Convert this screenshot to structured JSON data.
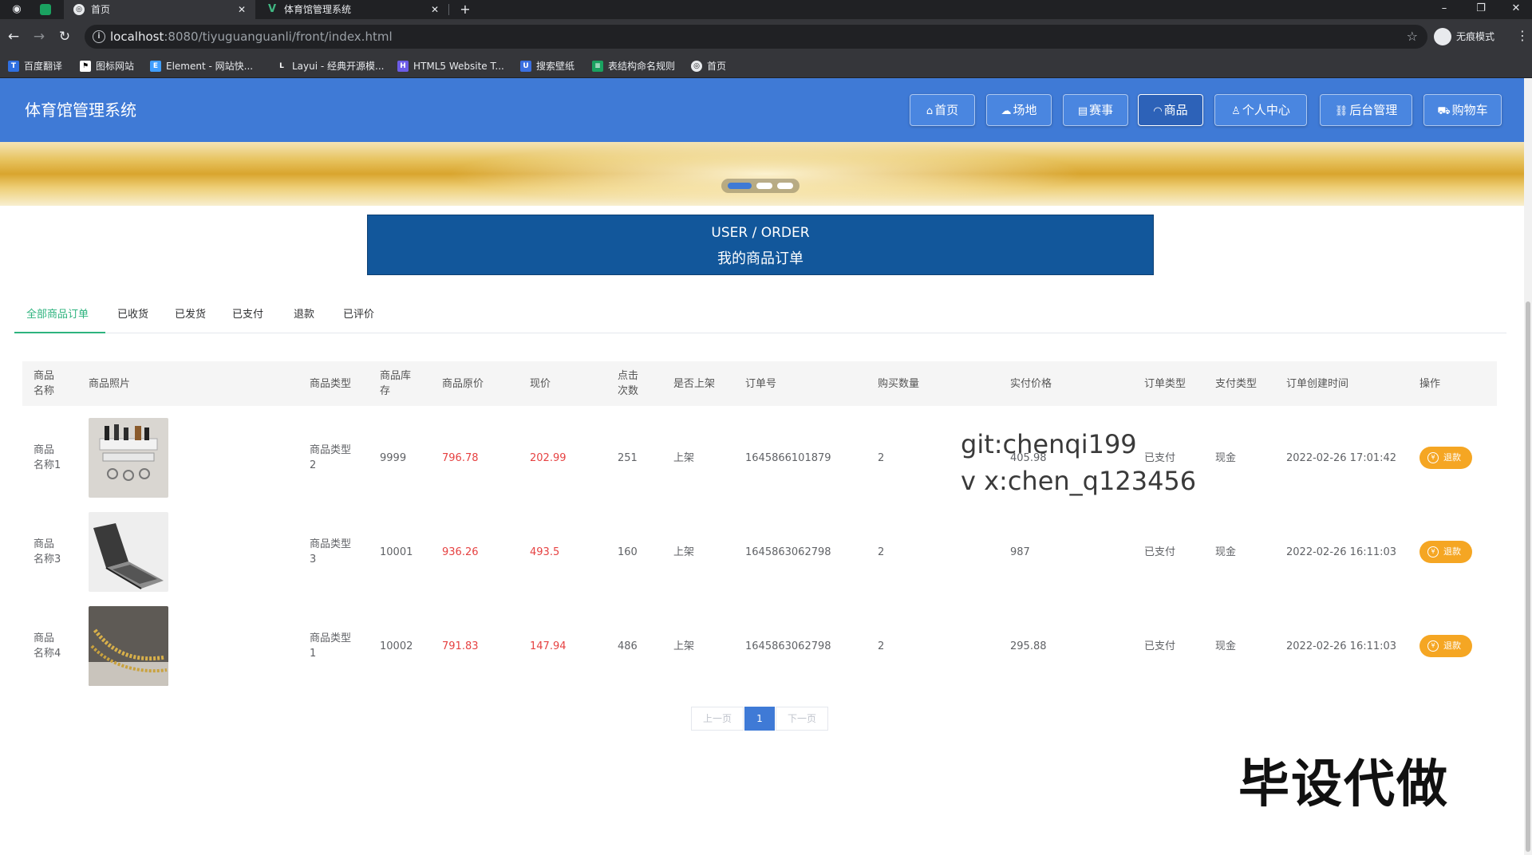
{
  "browser": {
    "tabs": [
      {
        "title": "首页",
        "active": true
      },
      {
        "title": "体育馆管理系统",
        "active": false
      }
    ],
    "new_tab": "+",
    "url_host": "localhost",
    "url_rest": ":8080/tiyuguanguanli/front/index.html",
    "incognito_label": "无痕模式",
    "bookmarks": [
      "百度翻译",
      "图标网站",
      "Element - 网站快...",
      "Layui - 经典开源模...",
      "HTML5 Website T...",
      "搜索壁纸",
      "表结构命名规则",
      "首页"
    ]
  },
  "header": {
    "site_title": "体育馆管理系统",
    "nav": [
      {
        "label": "首页",
        "icon": "home-icon"
      },
      {
        "label": "场地",
        "icon": "cloud-icon"
      },
      {
        "label": "赛事",
        "icon": "calendar-icon"
      },
      {
        "label": "商品",
        "icon": "bag-icon",
        "active": true
      },
      {
        "label": "个人中心",
        "icon": "user-icon"
      },
      {
        "label": "后台管理",
        "icon": "link-icon"
      },
      {
        "label": "购物车",
        "icon": "cart-icon"
      }
    ],
    "brand_color": "#3f7ad6"
  },
  "banner": {
    "active_slide": 1,
    "slide_count": 3
  },
  "section_title": {
    "en": "USER / ORDER",
    "cn": "我的商品订单"
  },
  "order_tabs": [
    "全部商品订单",
    "已收货",
    "已发货",
    "已支付",
    "退款",
    "已评价"
  ],
  "table": {
    "headers": [
      "商品\n名称",
      "商品照片",
      "商品类型",
      "商品库\n存",
      "商品原价",
      "现价",
      "点击\n次数",
      "是否上架",
      "订单号",
      "购买数量",
      "实付价格",
      "订单类型",
      "支付类型",
      "订单创建时间",
      "操作"
    ],
    "rows": [
      {
        "name": "商品\n名称1",
        "type": "商品类型\n2",
        "stock": "9999",
        "orig_price": "796.78",
        "price": "202.99",
        "clicks": "251",
        "on_shelf": "上架",
        "order_no": "1645866101879",
        "qty": "2",
        "paid": "405.98",
        "order_type": "已支付",
        "pay_type": "现金",
        "created": "2022-02-26 17:01:42",
        "action": "退款",
        "image": "knife-rack"
      },
      {
        "name": "商品\n名称3",
        "type": "商品类型\n3",
        "stock": "10001",
        "orig_price": "936.26",
        "price": "493.5",
        "clicks": "160",
        "on_shelf": "上架",
        "order_no": "1645863062798",
        "qty": "2",
        "paid": "987",
        "order_type": "已支付",
        "pay_type": "现金",
        "created": "2022-02-26 16:11:03",
        "action": "退款",
        "image": "laptop"
      },
      {
        "name": "商品\n名称4",
        "type": "商品类型\n1",
        "stock": "10002",
        "orig_price": "791.83",
        "price": "147.94",
        "clicks": "486",
        "on_shelf": "上架",
        "order_no": "1645863062798",
        "qty": "2",
        "paid": "295.88",
        "order_type": "已支付",
        "pay_type": "现金",
        "created": "2022-02-26 16:11:03",
        "action": "退款",
        "image": "gold-chain"
      }
    ]
  },
  "pagination": {
    "prev": "上一页",
    "current": "1",
    "next": "下一页"
  },
  "watermarks": {
    "line1": "git:chenqi199",
    "line2": "v x:chen_q123456",
    "big": "毕设代做"
  }
}
